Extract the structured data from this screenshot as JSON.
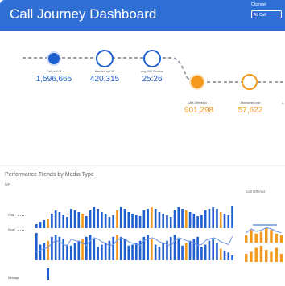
{
  "header": {
    "title": "Call Journey Dashboard",
    "control_label": "Channel",
    "control_value": "All Call"
  },
  "journey": {
    "nodes": [
      {
        "label": "Calls to IVR",
        "value": "1,596,665",
        "style": "filled-blue",
        "icon": "phone-icon"
      },
      {
        "label": "Handled by IVR",
        "value": "420,315",
        "style": "outline-blue",
        "icon": "check-icon"
      },
      {
        "label": "Avg. IVR Duration",
        "value": "25:26",
        "style": "outline-blue",
        "icon": "clock-icon"
      },
      {
        "label": "Calls Offered to",
        "value": "901,298",
        "style": "filled-orange",
        "icon": "phone-icon"
      },
      {
        "label": "Abandoned rate",
        "value": "57,622",
        "style": "outline-orange",
        "icon": "phone-icon"
      }
    ],
    "trailing_label": "A"
  },
  "performance": {
    "title": "Performance Trends by Media Type",
    "left_axis": "IVR",
    "right_axis": "Call Offered",
    "rows": [
      "Chat",
      "Email",
      "Message"
    ]
  },
  "colors": {
    "header_bg": "#2f6fd4",
    "blue": "#1f5fcf",
    "orange": "#f39a1e",
    "line_blue": "#6f96e6",
    "dash": "#9aa0a8"
  },
  "chart_data": {
    "type": "bar",
    "series": [
      {
        "name": "IVR",
        "values": [
          5,
          8,
          10,
          12,
          18,
          22,
          20,
          16,
          14,
          24,
          22,
          20,
          18,
          15,
          22,
          26,
          24,
          20,
          18,
          14,
          16,
          22,
          26,
          24,
          20,
          18,
          16,
          15,
          22,
          24,
          26,
          24,
          20,
          18,
          16,
          14,
          22,
          26,
          24,
          22,
          20,
          18,
          15,
          16,
          22,
          24,
          26,
          24,
          20,
          18,
          16,
          28
        ]
      },
      {
        "name": "Call Offered",
        "values": [
          8,
          14,
          10,
          12,
          16,
          14,
          10,
          8
        ]
      }
    ]
  }
}
